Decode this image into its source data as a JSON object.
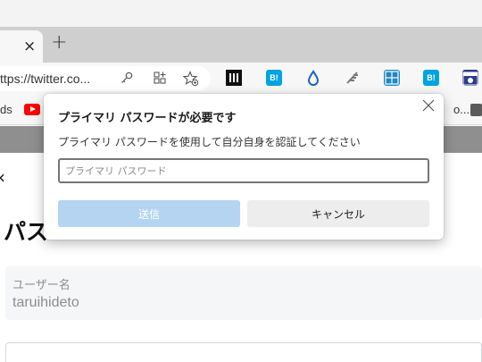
{
  "browser": {
    "tab": {
      "close_glyph": "×"
    },
    "new_tab_glyph": "+",
    "address_bar": {
      "url": "ttps://twitter.co..."
    },
    "extensions": [
      {
        "name": "archive-extension-icon",
        "label": "",
        "color": "#111111"
      },
      {
        "name": "hatena-bookmark-icon-1",
        "label": "B!",
        "color": "#00a4de"
      },
      {
        "name": "droplet-extension-icon",
        "label": "",
        "color": "#1565c0"
      },
      {
        "name": "feather-extension-icon",
        "label": "",
        "color": "#7a7a7a"
      },
      {
        "name": "grid-extension-icon",
        "label": "",
        "color": "#1e88c8"
      },
      {
        "name": "hatena-bookmark-icon-2",
        "label": "B!",
        "color": "#00a4de"
      },
      {
        "name": "calendar-extension-icon",
        "label": "",
        "color": "#2e3a8c"
      }
    ],
    "bookmarks": {
      "left_text": "ds",
      "right_text": "o..."
    }
  },
  "page": {
    "back_glyph": "‹",
    "heading": "パス",
    "username_label": "ユーザー名",
    "username_value": "taruihideto"
  },
  "dialog": {
    "title": "プライマリ パスワードが必要です",
    "description": "プライマリ パスワードを使用して自分自身を認証してください",
    "input_placeholder": "プライマリ パスワード",
    "input_value": "",
    "submit_label": "送信",
    "cancel_label": "キャンセル",
    "close_glyph": "╳"
  },
  "colors": {
    "submit_disabled": "#b4d4f1",
    "cancel_bg": "#ededed",
    "tab_bar": "#cfcfcf",
    "page_header": "#8f8f8f"
  }
}
